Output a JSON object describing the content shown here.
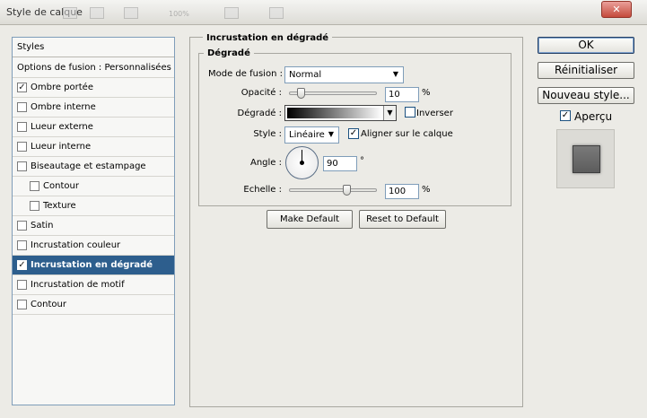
{
  "window": {
    "title": "Style de calque"
  },
  "toolbar_ghost": {
    "zoom": "100%"
  },
  "styles_list": {
    "header": "Styles",
    "blending_options": "Options de fusion : Personnalisées",
    "items": [
      {
        "label": "Ombre portée",
        "checked": "✓"
      },
      {
        "label": "Ombre interne",
        "checked": ""
      },
      {
        "label": "Lueur externe",
        "checked": ""
      },
      {
        "label": "Lueur interne",
        "checked": ""
      },
      {
        "label": "Biseautage et estampage",
        "checked": ""
      },
      {
        "label": "Contour",
        "checked": ""
      },
      {
        "label": "Texture",
        "checked": ""
      },
      {
        "label": "Satin",
        "checked": ""
      },
      {
        "label": "Incrustation couleur",
        "checked": ""
      },
      {
        "label": "Incrustation en dégradé",
        "checked": "✓",
        "selected": true
      },
      {
        "label": "Incrustation de motif",
        "checked": ""
      },
      {
        "label": "Contour",
        "checked": ""
      }
    ]
  },
  "panel": {
    "title": "Incrustation en dégradé",
    "section": "Dégradé",
    "blend_mode_label": "Mode de fusion :",
    "blend_mode_value": "Normal",
    "opacity_label": "Opacité :",
    "opacity_value": "10",
    "opacity_unit": "%",
    "opacity_fraction": 0.1,
    "gradient_label": "Dégradé :",
    "reverse_label": "Inverser",
    "reverse_checked": "",
    "style_label": "Style :",
    "style_value": "Linéaire",
    "align_label": "Aligner sur le calque",
    "align_checked": "✓",
    "angle_label": "Angle :",
    "angle_value": "90",
    "angle_unit": "°",
    "scale_label": "Echelle :",
    "scale_value": "100",
    "scale_unit": "%",
    "scale_fraction": 0.67,
    "make_default": "Make Default",
    "reset_default": "Reset to Default"
  },
  "right": {
    "ok": "OK",
    "reset": "Réinitialiser",
    "new_style": "Nouveau style...",
    "preview_label": "Aperçu",
    "preview_checked": "✓"
  },
  "colors": {
    "selection": "#2d5e8d",
    "background": "#ecebe6"
  }
}
